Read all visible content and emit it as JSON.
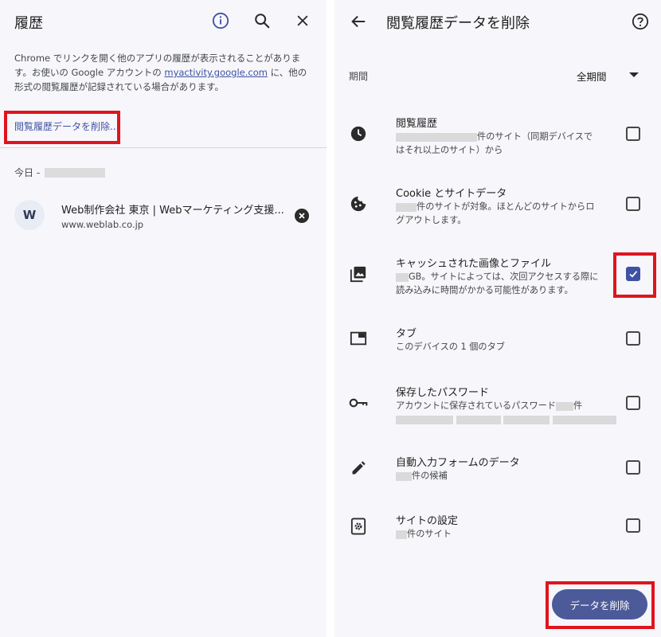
{
  "left": {
    "title": "履歴",
    "description": {
      "part1": "Chrome でリンクを開く他のアプリの履歴が表示されることがあります。お使いの Google アカウントの ",
      "link": "myactivity.google.com",
      "part2": " に、他の形式の閲覧履歴が記録されている場合があります。"
    },
    "clear_link": "閲覧履歴データを削除...",
    "today_label": "今日 -",
    "item": {
      "favicon_letter": "W",
      "title": "Web制作会社 東京 | Webマーケティング支援...",
      "url": "www.weblab.co.jp"
    }
  },
  "right": {
    "title": "閲覧履歴データを削除",
    "period_label": "期間",
    "period_value": "全期間",
    "rows": [
      {
        "title": "閲覧履歴",
        "desc_a": "件のサイト（同期デバイスで",
        "desc_b": "はそれ以上のサイト）から",
        "checked": false
      },
      {
        "title": "Cookie とサイトデータ",
        "desc_a": "件のサイトが対象。ほとんどのサイトからロ",
        "desc_b": "グアウトします。",
        "checked": false
      },
      {
        "title": "キャッシュされた画像とファイル",
        "desc_a": "GB。サイトによっては、次回アクセスする際に",
        "desc_b": "読み込みに時間がかかる可能性があります。",
        "checked": true
      },
      {
        "title": "タブ",
        "desc_a": "このデバイスの 1 個のタブ",
        "desc_b": "",
        "checked": false
      },
      {
        "title": "保存したパスワード",
        "desc_a": "アカウントに保存されているパスワード",
        "desc_a2": "件",
        "desc_b": "",
        "checked": false
      },
      {
        "title": "自動入力フォームのデータ",
        "desc_a": "件の候補",
        "desc_b": "",
        "checked": false
      },
      {
        "title": "サイトの設定",
        "desc_a": "件のサイト",
        "desc_b": "",
        "checked": false
      }
    ],
    "delete_button": "データを削除"
  },
  "colors": {
    "accent": "#3f51a3",
    "highlight_box": "#e0141e",
    "button": "#4c5a99",
    "background": "#f7f7fb"
  },
  "icons": [
    "info-icon",
    "search-icon",
    "close-icon",
    "back-arrow-icon",
    "help-icon",
    "clock-icon",
    "cookie-icon",
    "image-icon",
    "tab-icon",
    "key-icon",
    "pencil-icon",
    "site-settings-icon",
    "checkmark-icon",
    "remove-icon"
  ]
}
